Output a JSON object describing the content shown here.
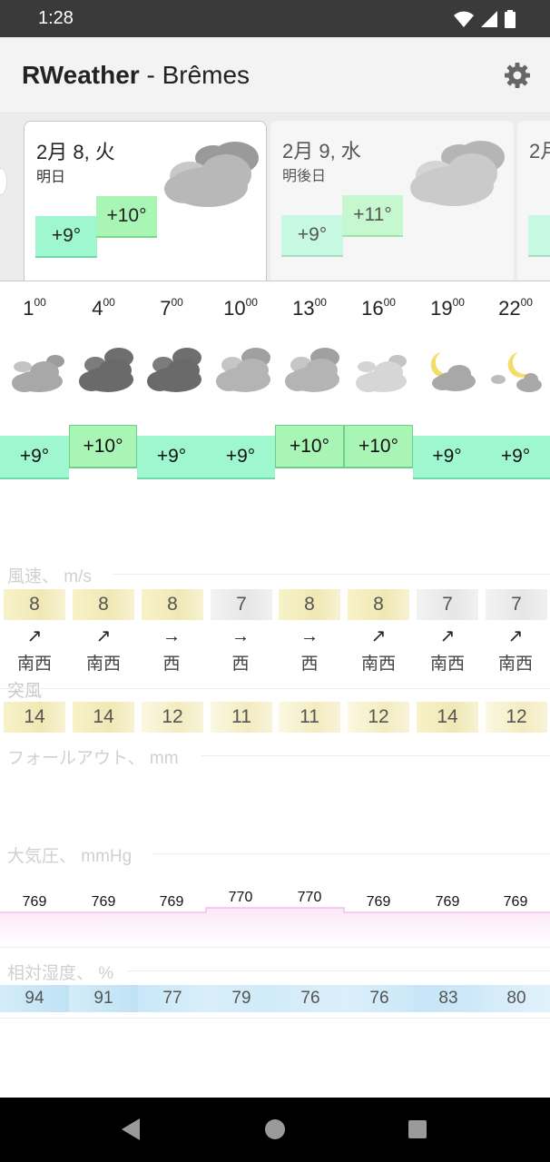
{
  "status_bar": {
    "time": "1:28",
    "icons": [
      "wifi-icon",
      "signal-icon",
      "battery-icon"
    ]
  },
  "app_bar": {
    "app_name": "RWeather",
    "separator": " - ",
    "city": "Brêmes",
    "settings_icon": "gear-icon"
  },
  "days": [
    {
      "date": "2月 8, 火",
      "relative": "明日",
      "low": "+9°",
      "high": "+10°",
      "icon": "cloudy-icon"
    },
    {
      "date": "2月 9, 水",
      "relative": "明後日",
      "low": "+9°",
      "high": "+11°",
      "icon": "cloudy-icon"
    },
    {
      "date": "2月",
      "relative": "",
      "low": "+",
      "high": "",
      "icon": "cloudy-icon"
    }
  ],
  "hourly": {
    "hours": [
      {
        "h": "1",
        "m": "00"
      },
      {
        "h": "4",
        "m": "00"
      },
      {
        "h": "7",
        "m": "00"
      },
      {
        "h": "10",
        "m": "00"
      },
      {
        "h": "13",
        "m": "00"
      },
      {
        "h": "16",
        "m": "00"
      },
      {
        "h": "19",
        "m": "00"
      },
      {
        "h": "22",
        "m": "00"
      }
    ],
    "icons": [
      "cloudy-icon",
      "overcast-icon",
      "overcast-icon",
      "cloudy-icon",
      "cloudy-icon",
      "light-cloud-icon",
      "moon-cloud-icon",
      "moon-cloud-icon"
    ],
    "temps": [
      "+9°",
      "+10°",
      "+9°",
      "+9°",
      "+10°",
      "+10°",
      "+9°",
      "+9°"
    ],
    "temp_levels": [
      9,
      10,
      9,
      9,
      10,
      10,
      9,
      9
    ]
  },
  "wind": {
    "label": "風速、 m/s",
    "speeds": [
      "8",
      "8",
      "8",
      "7",
      "8",
      "8",
      "7",
      "7"
    ],
    "arrows": [
      "↗",
      "↗",
      "→",
      "→",
      "→",
      "↗",
      "↗",
      "↗"
    ],
    "directions": [
      "南西",
      "南西",
      "西",
      "西",
      "西",
      "南西",
      "南西",
      "南西"
    ]
  },
  "gusts": {
    "label": "突風",
    "values": [
      "14",
      "14",
      "12",
      "11",
      "11",
      "12",
      "14",
      "12"
    ]
  },
  "precip": {
    "label": "フォールアウト、 mm"
  },
  "pressure": {
    "label": "大気圧、 mmHg",
    "values": [
      "769",
      "769",
      "769",
      "770",
      "770",
      "769",
      "769",
      "769"
    ]
  },
  "humidity": {
    "label": "相対湿度、 %",
    "values": [
      "94",
      "91",
      "77",
      "79",
      "76",
      "76",
      "83",
      "80"
    ]
  },
  "nav_bar": {
    "buttons": [
      "back-icon",
      "home-icon",
      "recents-icon"
    ]
  },
  "colors": {
    "temp_green": "#9ef7cf",
    "temp_green_high": "#a8f5b6",
    "wind_yellow": "#f0e8b4",
    "humidity_blue": "#bfe2f5",
    "pressure_pink": "#f5c6f0"
  }
}
